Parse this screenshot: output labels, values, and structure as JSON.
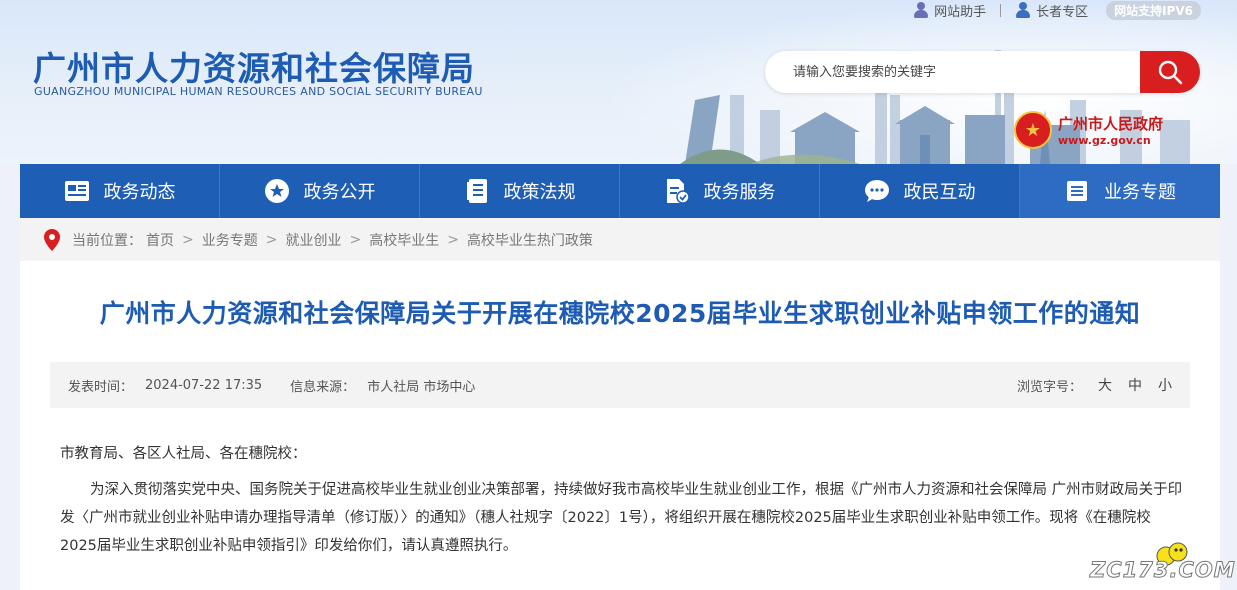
{
  "topbar": {
    "assistant_label": "网站助手",
    "elder_label": "长者专区",
    "ipv6_label": "网站支持IPV6"
  },
  "header": {
    "logo_cn": "广州市人力资源和社会保障局",
    "logo_en": "GUANGZHOU MUNICIPAL HUMAN RESOURCES AND SOCIAL SECURITY BUREAU",
    "search_placeholder": "请输入您要搜索的关键字",
    "gov_name": "广州市人民政府",
    "gov_url": "www.gz.gov.cn"
  },
  "nav": {
    "items": [
      {
        "label": "政务动态",
        "icon": "news-icon"
      },
      {
        "label": "政务公开",
        "icon": "star-icon"
      },
      {
        "label": "政策法规",
        "icon": "document-icon"
      },
      {
        "label": "政务服务",
        "icon": "service-icon"
      },
      {
        "label": "政民互动",
        "icon": "chat-icon"
      },
      {
        "label": "业务专题",
        "icon": "topic-icon"
      }
    ]
  },
  "breadcrumb": {
    "prefix": "当前位置：",
    "items": [
      "首页",
      "业务专题",
      "就业创业",
      "高校毕业生",
      "高校毕业生热门政策"
    ]
  },
  "article": {
    "title": "广州市人力资源和社会保障局关于开展在穗院校2025届毕业生求职创业补贴申领工作的通知",
    "meta": {
      "date_label": "发表时间：",
      "date_value": "2024-07-22 17:35",
      "source_label": "信息来源：",
      "source_value": "市人社局 市场中心",
      "font_label": "浏览字号：",
      "font_large": "大",
      "font_medium": "中",
      "font_small": "小"
    },
    "salutation": "市教育局、各区人社局、各在穗院校：",
    "paragraph1": "为深入贯彻落实党中央、国务院关于促进高校毕业生就业创业决策部署，持续做好我市高校毕业生就业创业工作，根据《广州市人力资源和社会保障局 广州市财政局关于印发〈广州市就业创业补贴申请办理指导清单（修订版）〉的通知》（穗人社规字〔2022〕1号），将组织开展在穗院校2025届毕业生求职创业补贴申领工作。现将《在穗院校2025届毕业生求职创业补贴申领指引》印发给你们，请认真遵照执行。"
  },
  "watermark": {
    "text": "ZC173.COM"
  }
}
